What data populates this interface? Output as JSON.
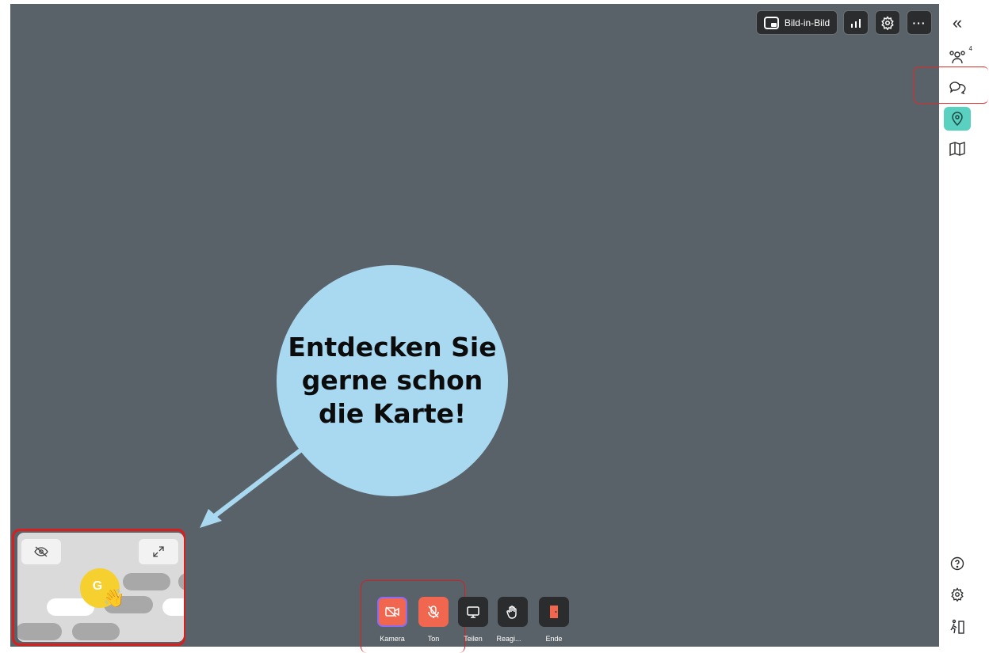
{
  "toolbar": {
    "pip_label": "Bild-in-Bild",
    "stats_icon": "bar-chart-icon",
    "settings_icon": "gear-icon",
    "more_label": "···"
  },
  "sidebar": {
    "collapse": "«",
    "participants_count": "4",
    "items": [
      {
        "name": "participants",
        "icon": "people-icon"
      },
      {
        "name": "chat",
        "icon": "chat-bubbles-icon"
      },
      {
        "name": "location",
        "icon": "map-pin-icon",
        "active": true
      },
      {
        "name": "map",
        "icon": "map-icon"
      },
      {
        "name": "help",
        "icon": "question-circle-icon"
      },
      {
        "name": "settings",
        "icon": "gear-icon"
      },
      {
        "name": "leave",
        "icon": "exit-icon"
      }
    ],
    "active_color": "#5ad0c0"
  },
  "callout": {
    "text": "Entdecken Sie gerne schon die Karte!",
    "bubble_color": "#a9d9f1"
  },
  "minimap": {
    "avatar_letter": "G",
    "avatar_color": "#f6d02f",
    "reaction": "👋"
  },
  "controls": [
    {
      "label": "Kamera",
      "icon": "camera-off-icon",
      "color": "#f0664f"
    },
    {
      "label": "Ton",
      "icon": "mic-off-icon",
      "color": "#f0664f"
    },
    {
      "label": "Teilen",
      "icon": "monitor-icon",
      "color": "#2b2c2e"
    },
    {
      "label": "Reagi...",
      "icon": "hand-icon",
      "color": "#2b2c2e"
    },
    {
      "label": "Ende",
      "icon": "door-exit-icon",
      "color": "#2b2c2e"
    }
  ],
  "colors": {
    "stage": "#596268",
    "highlight": "#d91e1e"
  }
}
